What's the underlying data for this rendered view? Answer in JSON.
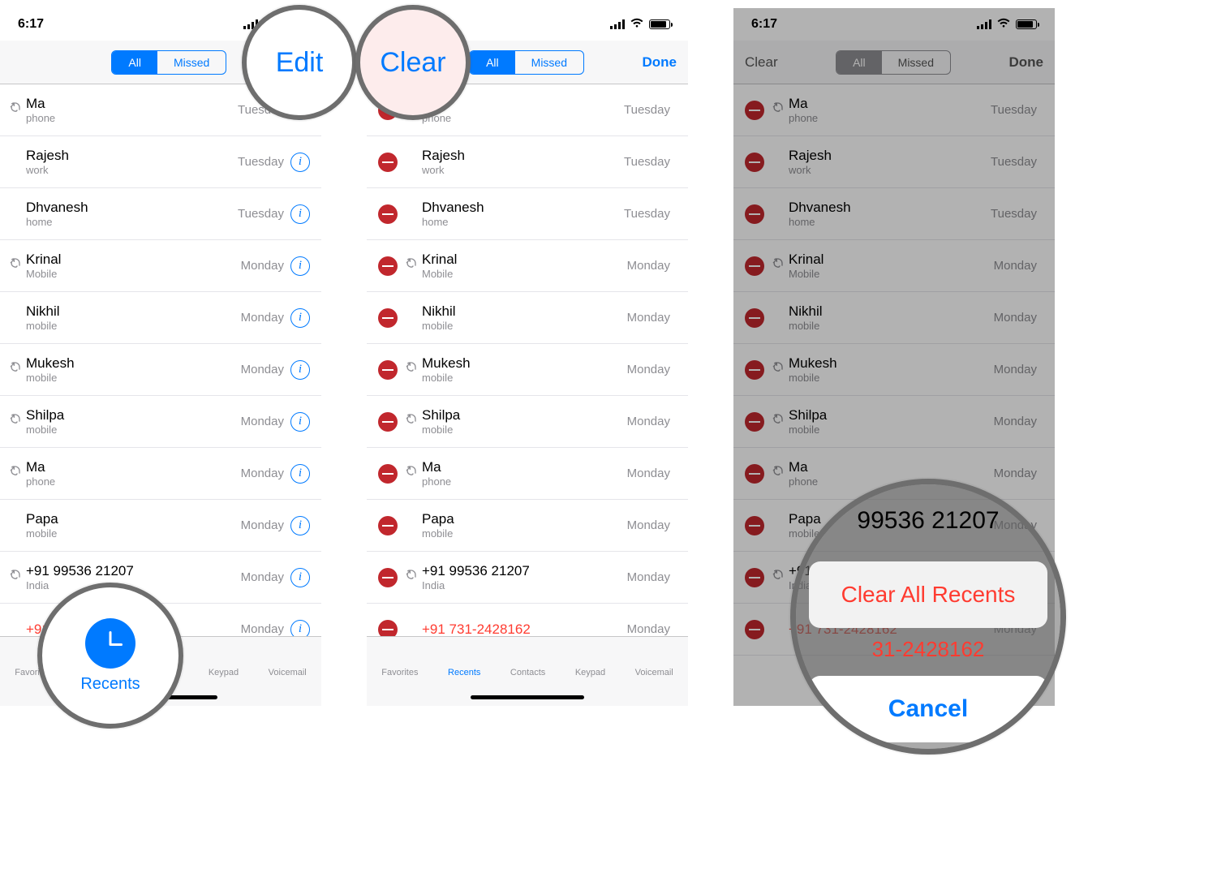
{
  "status": {
    "time": "6:17"
  },
  "colors": {
    "accent": "#007AFF",
    "danger": "#FF3B30",
    "deleteRed": "#C1272D",
    "gray": "#8E8E93"
  },
  "seg": {
    "all": "All",
    "missed": "Missed"
  },
  "nav": {
    "edit": "Edit",
    "clear": "Clear",
    "done": "Done"
  },
  "calls": [
    {
      "name": "Ma",
      "sub": "phone",
      "time": "Tuesday",
      "outgoing": true,
      "missed": false
    },
    {
      "name": "Rajesh",
      "sub": "work",
      "time": "Tuesday",
      "outgoing": false,
      "missed": false
    },
    {
      "name": "Dhvanesh",
      "sub": "home",
      "time": "Tuesday",
      "outgoing": false,
      "missed": false
    },
    {
      "name": "Krinal",
      "sub": "Mobile",
      "time": "Monday",
      "outgoing": true,
      "missed": false
    },
    {
      "name": "Nikhil",
      "sub": "mobile",
      "time": "Monday",
      "outgoing": false,
      "missed": false
    },
    {
      "name": "Mukesh",
      "sub": "mobile",
      "time": "Monday",
      "outgoing": true,
      "missed": false
    },
    {
      "name": "Shilpa",
      "sub": "mobile",
      "time": "Monday",
      "outgoing": true,
      "missed": false
    },
    {
      "name": "Ma",
      "sub": "phone",
      "time": "Monday",
      "outgoing": true,
      "missed": false
    },
    {
      "name": "Papa",
      "sub": "mobile",
      "time": "Monday",
      "outgoing": false,
      "missed": false
    },
    {
      "name": "+91 99536 21207",
      "sub": "India",
      "time": "Monday",
      "outgoing": true,
      "missed": false
    },
    {
      "name": "+91 731-2428162",
      "sub": "",
      "time": "Monday",
      "outgoing": false,
      "missed": true
    }
  ],
  "tabs": {
    "favorites": "Favorites",
    "recents": "Recents",
    "contacts": "Contacts",
    "keypad": "Keypad",
    "voicemail": "Voicemail"
  },
  "magnifiers": {
    "edit": "Edit",
    "clear": "Clear",
    "recents": "Recents",
    "sheet_num_top": "99536 21207",
    "sheet_clear_all": "Clear All Recents",
    "sheet_num_mid": "31-2428162",
    "sheet_cancel": "Cancel"
  }
}
